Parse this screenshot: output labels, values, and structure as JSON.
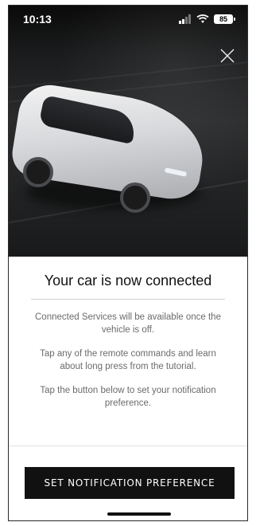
{
  "status_bar": {
    "time": "10:13",
    "battery_level": "85"
  },
  "modal": {
    "close_icon": "close-icon",
    "title": "Your car is now connected",
    "paragraphs": [
      "Connected Services will be available once the vehicle is off.",
      "Tap any of the remote commands and learn about long press from the tutorial.",
      "Tap the button below to set your notification preference."
    ],
    "cta_label": "SET NOTIFICATION PREFERENCE"
  },
  "colors": {
    "cta_background": "#111111",
    "cta_text": "#ffffff",
    "body_text": "#6b6b6b",
    "hero_dark": "#1b1c1d"
  }
}
